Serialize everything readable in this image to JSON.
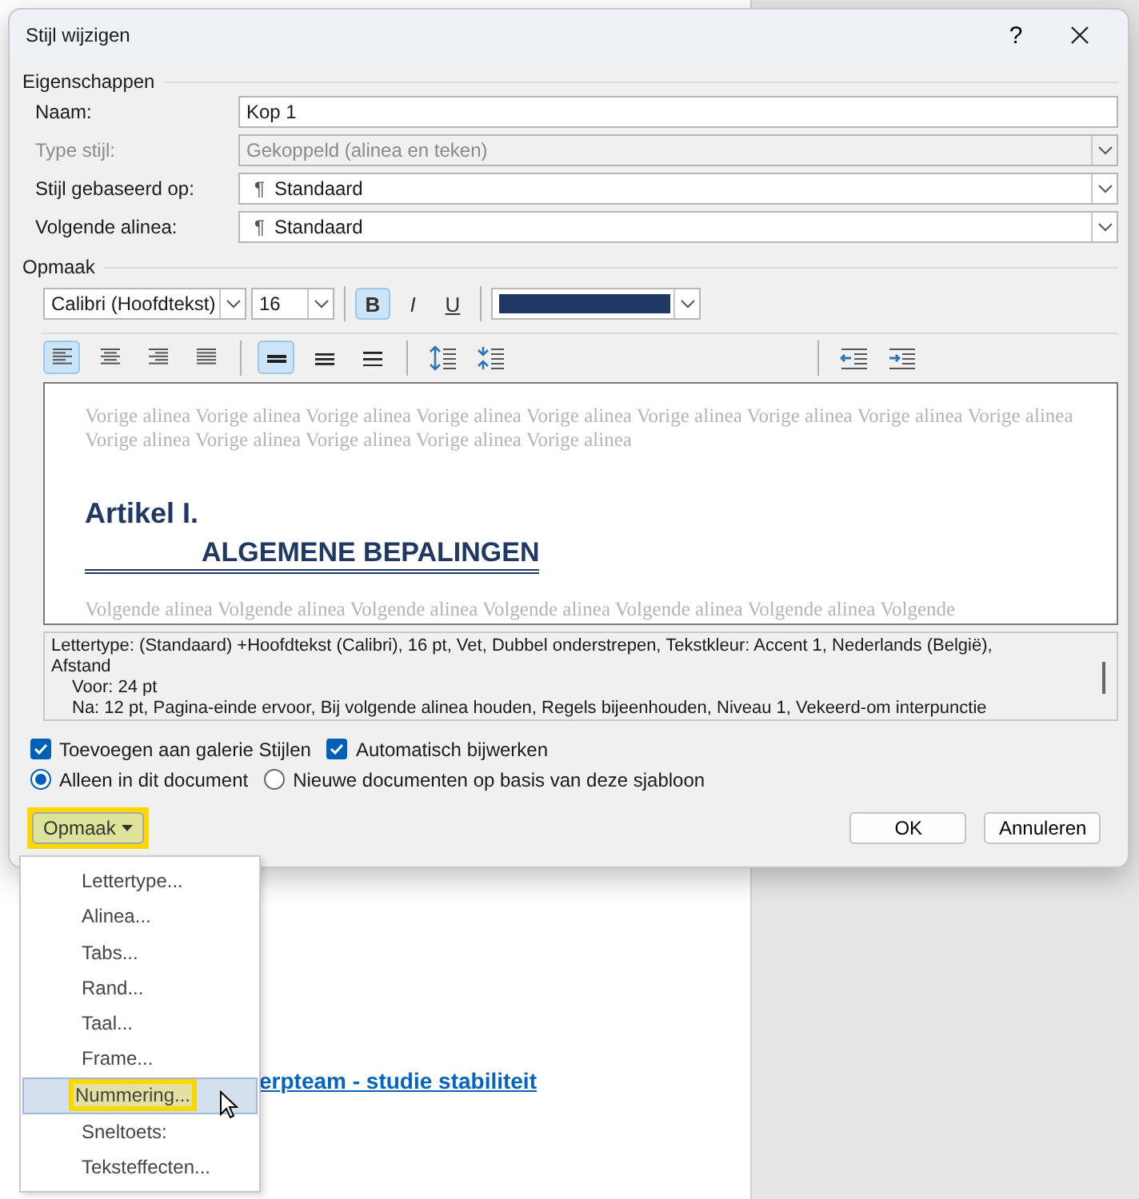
{
  "dialog": {
    "title": "Stijl wijzigen",
    "help": "?"
  },
  "properties": {
    "heading": "Eigenschappen",
    "fields": [
      {
        "label": "Naam:",
        "value": "Kop 1",
        "kind": "text",
        "disabled": false
      },
      {
        "label": "Type stijl:",
        "value": "Gekoppeld (alinea en teken)",
        "kind": "dropdown",
        "disabled": true
      },
      {
        "label": "Stijl gebaseerd op:",
        "value": "Standaard",
        "kind": "dropdown",
        "disabled": false,
        "icon": "¶"
      },
      {
        "label": "Volgende alinea:",
        "value": "Standaard",
        "kind": "dropdown",
        "disabled": false,
        "icon": "¶"
      }
    ]
  },
  "formatting": {
    "heading": "Opmaak",
    "font": "Calibri (Hoofdtekst)",
    "size": "16",
    "color": "#1f3864",
    "styles": [
      {
        "label": "B",
        "kind": "bold",
        "selected": true
      },
      {
        "label": "I",
        "kind": "italic",
        "selected": false
      },
      {
        "label": "U",
        "kind": "underline",
        "selected": false
      }
    ],
    "alignment": [
      {
        "kind": "left",
        "selected": true
      },
      {
        "kind": "center",
        "selected": false
      },
      {
        "kind": "right",
        "selected": false
      },
      {
        "kind": "justify",
        "selected": false
      }
    ],
    "line_spacing": [
      {
        "kind": "single",
        "selected": true
      },
      {
        "kind": "one-half",
        "selected": false
      },
      {
        "kind": "double",
        "selected": false
      }
    ]
  },
  "preview": {
    "previous": "Vorige alinea Vorige alinea Vorige alinea Vorige alinea Vorige alinea Vorige alinea Vorige alinea Vorige alinea Vorige alinea Vorige alinea Vorige alinea Vorige alinea Vorige alinea Vorige alinea",
    "heading_number": "Artikel I.",
    "heading_title": "ALGEMENE BEPALINGEN",
    "next": "Volgende alinea Volgende alinea Volgende alinea Volgende alinea Volgende alinea Volgende alinea Volgende"
  },
  "description": [
    "Lettertype: (Standaard) +Hoofdtekst (Calibri), 16 pt, Vet, Dubbel onderstrepen, Tekstkleur: Accent 1, Nederlands (België),",
    "Afstand",
    "Voor:  24 pt",
    "Na:  12 pt, Pagina-einde ervoor, Bij volgende alinea houden, Regels bijeenhouden, Niveau 1, Vekeerd-om interpunctie"
  ],
  "checkboxes": [
    {
      "label": "Toevoegen aan galerie Stijlen",
      "checked": true
    },
    {
      "label": "Automatisch bijwerken",
      "checked": true
    }
  ],
  "radios": [
    {
      "label": "Alleen in dit document",
      "selected": true
    },
    {
      "label": "Nieuwe documenten op basis van deze sjabloon",
      "selected": false
    }
  ],
  "buttons": {
    "format": {
      "label": "Opmaak",
      "highlighted": true
    },
    "ok": "OK",
    "cancel": "Annuleren"
  },
  "menu": [
    {
      "label": "Lettertype...",
      "selected": false
    },
    {
      "label": "Alinea...",
      "selected": false
    },
    {
      "label": "Tabs...",
      "selected": false
    },
    {
      "label": "Rand...",
      "selected": false
    },
    {
      "label": "Taal...",
      "selected": false
    },
    {
      "label": "Frame...",
      "selected": false
    },
    {
      "label": "Nummering...",
      "selected": true
    },
    {
      "label": "Sneltoets:",
      "selected": false
    },
    {
      "label": "Teksteffecten...",
      "selected": false
    }
  ],
  "document": {
    "link": "erpteam - studie stabiliteit"
  }
}
